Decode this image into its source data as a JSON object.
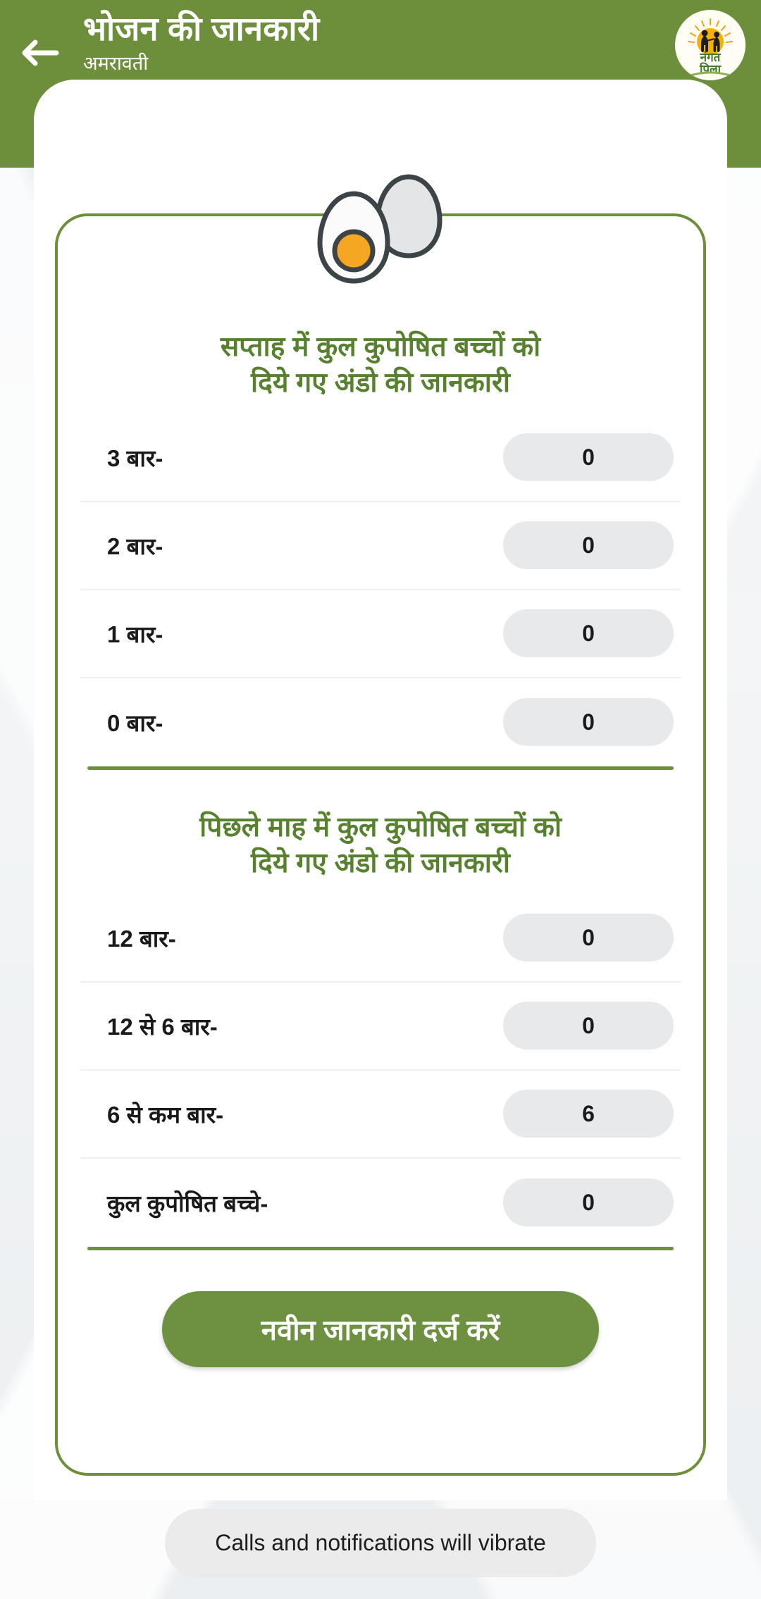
{
  "header": {
    "back_icon": "arrow-left-icon",
    "title": "भोजन की जानकारी",
    "subtitle": "अमरावती",
    "logo": {
      "icon": "nangat-pila-logo",
      "line1": "नंगत",
      "line2": "पिला"
    }
  },
  "decor": {
    "egg_icon": "boiled-eggs-icon"
  },
  "sections": [
    {
      "title": "सप्ताह में कुल कुपोषित बच्चों को\nदिये गए अंडो  की जानकारी",
      "rows": [
        {
          "label": "3 बार-",
          "value": "0"
        },
        {
          "label": "2 बार-",
          "value": "0"
        },
        {
          "label": "1 बार-",
          "value": "0"
        },
        {
          "label": "0 बार-",
          "value": "0"
        }
      ]
    },
    {
      "title": "पिछले माह में कुल कुपोषित बच्चों को\nदिये गए अंडो  की जानकारी",
      "rows": [
        {
          "label": "12 बार-",
          "value": "0"
        },
        {
          "label": "12 से 6 बार-",
          "value": "0"
        },
        {
          "label": "6 से कम बार-",
          "value": "6"
        },
        {
          "label": "कुल कुपोषित बच्चे-",
          "value": "0"
        }
      ]
    }
  ],
  "submit_button": {
    "label": "नवीन जानकारी दर्ज करें"
  },
  "toast": {
    "message": "Calls and notifications will vibrate"
  },
  "colors": {
    "brand_green": "#6d8f3c",
    "button_green": "#6d9140",
    "heading_green": "#57812f",
    "field_grey": "#e8e9ea",
    "toast_grey": "#ebebeb",
    "yolk_yellow": "#f5a623"
  }
}
